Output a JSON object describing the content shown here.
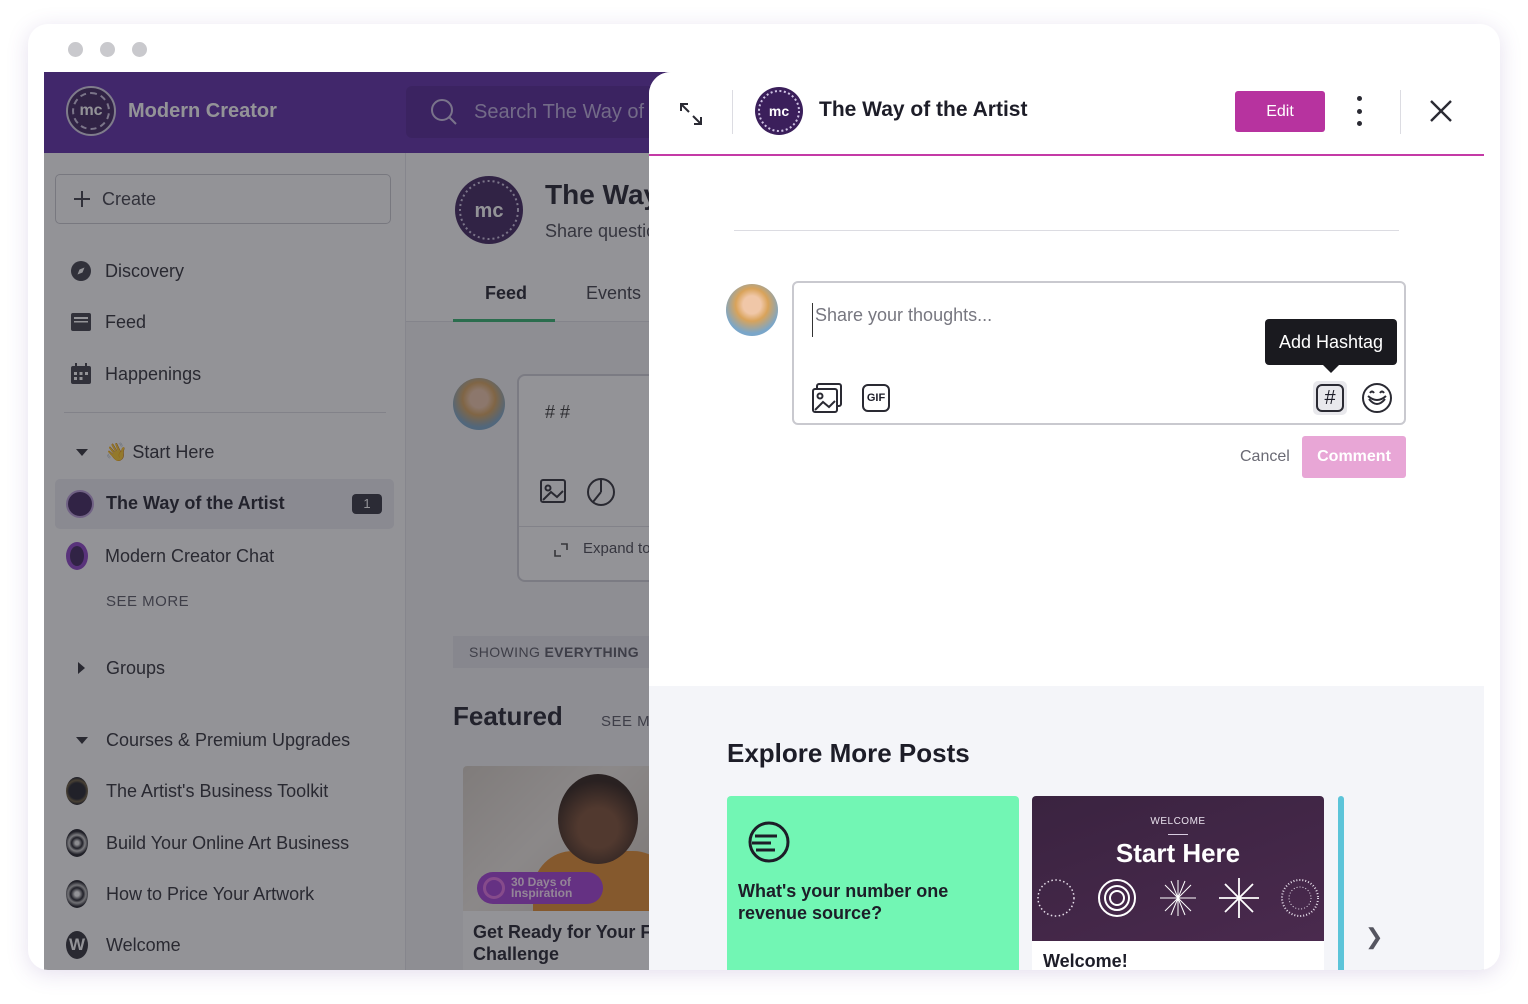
{
  "app": {
    "brand": "Modern Creator",
    "logo_text": "mc",
    "search_placeholder": "Search The Way of the Artist"
  },
  "sidebar": {
    "create_label": "Create",
    "nav": [
      {
        "label": "Discovery",
        "icon": "compass-icon"
      },
      {
        "label": "Feed",
        "icon": "feed-icon"
      },
      {
        "label": "Happenings",
        "icon": "calendar-icon"
      }
    ],
    "start_here": "👋 Start Here",
    "spaces": [
      {
        "label": "The Way of the Artist",
        "badge": "1",
        "active": true
      },
      {
        "label": "Modern Creator Chat"
      }
    ],
    "see_more": "SEE MORE",
    "groups_label": "Groups",
    "courses_label": "Courses & Premium Upgrades",
    "courses": [
      {
        "label": "The Artist's Business Toolkit"
      },
      {
        "label": "Build Your Online Art Business"
      },
      {
        "label": "How to Price Your Artwork"
      },
      {
        "label": "Welcome",
        "icon_text": "W"
      }
    ]
  },
  "main": {
    "title": "The Way of the Artist",
    "subtitle": "Share questions, ideas and more",
    "tabs": [
      "Feed",
      "Events"
    ],
    "compose_hash": "# #",
    "expand_label": "Expand to full editor",
    "showing_prefix": "SHOWING",
    "showing_bold": "EVERYTHING",
    "featured_label": "Featured",
    "see_more": "SEE MORE",
    "featured_card": {
      "pill_line1": "30 Days of",
      "pill_line2": "Inspiration",
      "title": "Get Ready for Your First Challenge"
    }
  },
  "drawer": {
    "title": "The Way of the Artist",
    "edit_label": "Edit",
    "comment_placeholder": "Share your thoughts...",
    "tooltip": "Add Hashtag",
    "gif_label": "GIF",
    "hash_symbol": "#",
    "cancel_label": "Cancel",
    "comment_label": "Comment",
    "explore_title": "Explore More Posts",
    "posts": [
      {
        "text": "What's your number one revenue source?",
        "bg": "#72f6b4"
      },
      {
        "banner_small": "WELCOME",
        "banner_title": "Start Here",
        "title": "Welcome!"
      }
    ]
  },
  "colors": {
    "brand_purple": "#5b27a6",
    "accent_magenta": "#b7339f",
    "comment_disabled": "#e8a6d6",
    "feed_tab_green": "#2fb36c"
  }
}
